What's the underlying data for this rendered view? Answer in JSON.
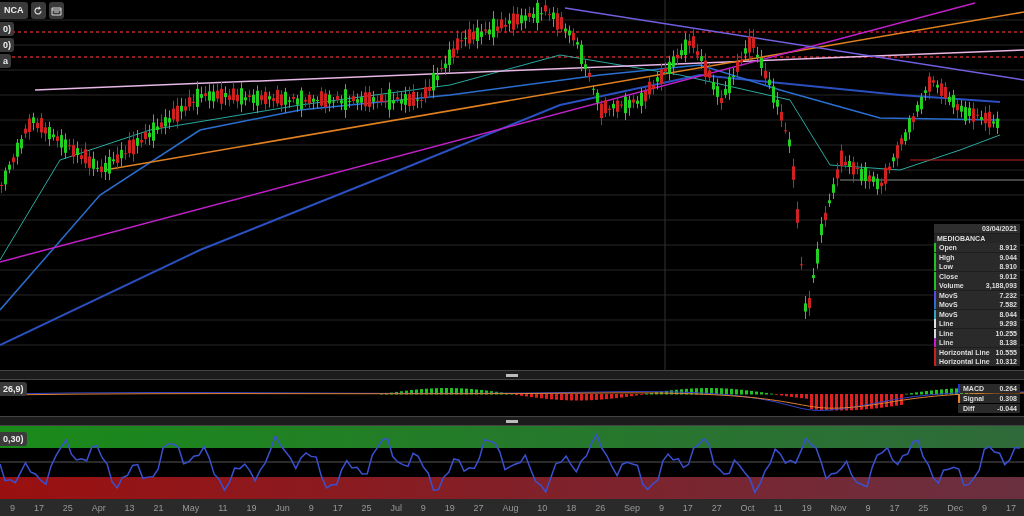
{
  "toolbar": {
    "symbol": "NCA"
  },
  "study_labels": [
    "0)",
    "0)",
    "a"
  ],
  "legend": {
    "date": "03/04/2021",
    "title": "MEDIOBANCA",
    "rows": [
      {
        "label": "Open",
        "value": "8.912",
        "color": "#22c022"
      },
      {
        "label": "High",
        "value": "9.044",
        "color": "#22c022"
      },
      {
        "label": "Low",
        "value": "8.910",
        "color": "#22c022"
      },
      {
        "label": "Close",
        "value": "9.012",
        "color": "#22c022"
      },
      {
        "label": "Volume",
        "value": "3,188,093",
        "color": "#22c022"
      },
      {
        "label": "MovS",
        "value": "7.232",
        "color": "#5a4ce0"
      },
      {
        "label": "MovS",
        "value": "7.582",
        "color": "#2a6fd0"
      },
      {
        "label": "MovS",
        "value": "8.044",
        "color": "#2aa8c0"
      },
      {
        "label": "Line",
        "value": "9.293",
        "color": "#e0e0e0"
      },
      {
        "label": "Line",
        "value": "10.255",
        "color": "#d8d8d8"
      },
      {
        "label": "Line",
        "value": "8.138",
        "color": "#c020c8"
      },
      {
        "label": "Horizontal Line",
        "value": "10.555",
        "color": "#c82020"
      },
      {
        "label": "Horizontal Line",
        "value": "10.312",
        "color": "#c82020"
      }
    ]
  },
  "macd": {
    "label": "26,9)",
    "legend": [
      {
        "label": "MACD",
        "value": "0.264",
        "color": "#2233cc"
      },
      {
        "label": "Signal",
        "value": "0.308",
        "color": "#e08030"
      },
      {
        "label": "Diff",
        "value": "-0.044"
      }
    ]
  },
  "rsi": {
    "label": "0,30)"
  },
  "x_axis": [
    "9",
    "17",
    "25",
    "Apr",
    "13",
    "21",
    "May",
    "11",
    "19",
    "Jun",
    "9",
    "17",
    "25",
    "Jul",
    "9",
    "19",
    "27",
    "Aug",
    "10",
    "18",
    "26",
    "Sep",
    "9",
    "17",
    "27",
    "Oct",
    "11",
    "19",
    "Nov",
    "9",
    "17",
    "25",
    "Dec",
    "9",
    "17"
  ]
}
